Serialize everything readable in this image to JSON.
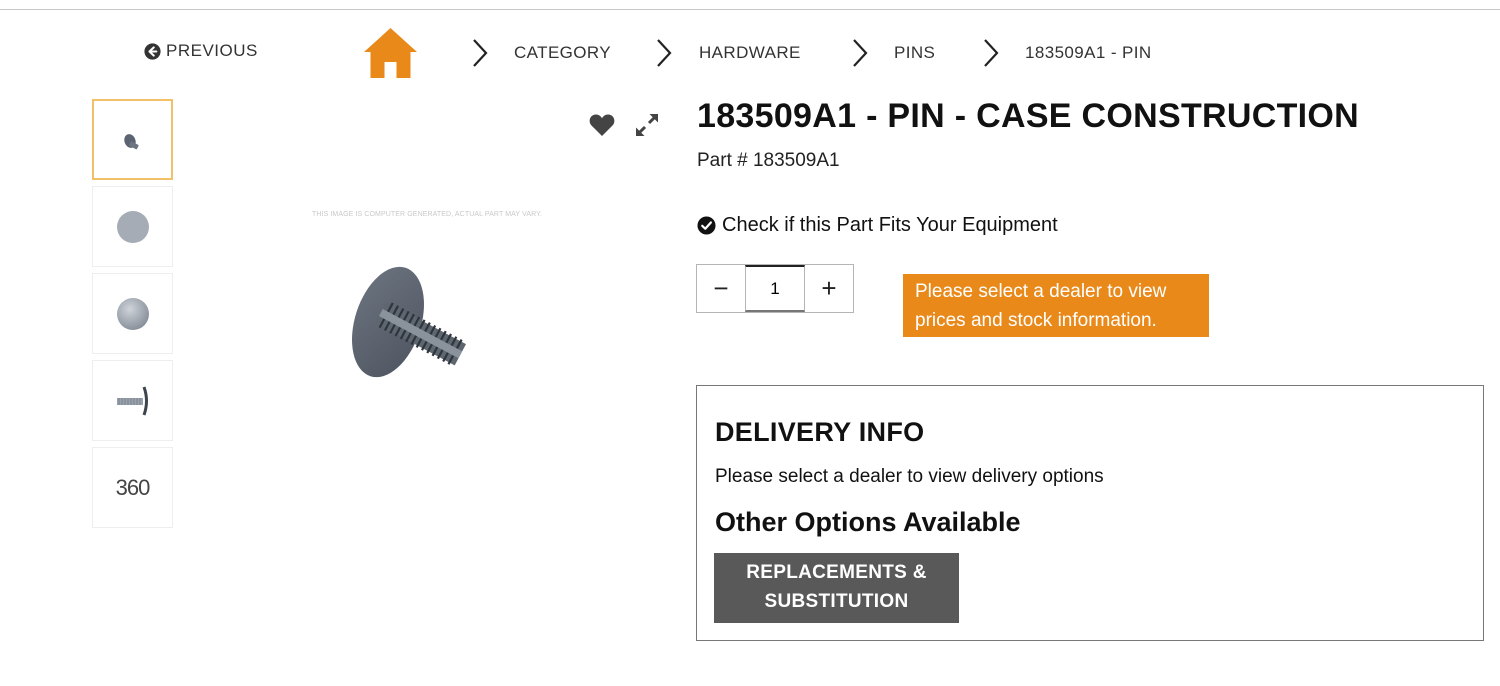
{
  "nav": {
    "previous_label": "PREVIOUS",
    "breadcrumbs": [
      {
        "label": "CATEGORY"
      },
      {
        "label": "HARDWARE"
      },
      {
        "label": "PINS"
      },
      {
        "label": "183509A1 - PIN"
      }
    ],
    "home_icon": "home-icon",
    "accent_color": "#e8891a"
  },
  "gallery": {
    "thumbnails": [
      {
        "icon": "pin-angle-thumbnail",
        "active": true
      },
      {
        "icon": "pin-head-front-thumbnail"
      },
      {
        "icon": "pin-head-sphere-thumbnail"
      },
      {
        "icon": "pin-side-thumbnail"
      },
      {
        "label": "360"
      }
    ],
    "disclaimer": "THIS IMAGE IS COMPUTER GENERATED, ACTUAL PART MAY VARY.",
    "favorite_icon": "heart-icon",
    "expand_icon": "expand-icon"
  },
  "product": {
    "title": "183509A1 - PIN - CASE CONSTRUCTION",
    "part_number": "Part # 183509A1",
    "fit_check_label": "Check if this Part Fits Your Equipment",
    "quantity": "1",
    "decrement_label": "−",
    "increment_label": "+",
    "dealer_notice": "Please select a dealer to view prices and stock information.",
    "notice_color": "#e8891a"
  },
  "delivery": {
    "title": "DELIVERY INFO",
    "text": "Please select a dealer to view delivery options",
    "other_title": "Other Options Available",
    "button_line1": "REPLACEMENTS &",
    "button_line2": "SUBSTITUTION",
    "button_color": "#595959"
  }
}
